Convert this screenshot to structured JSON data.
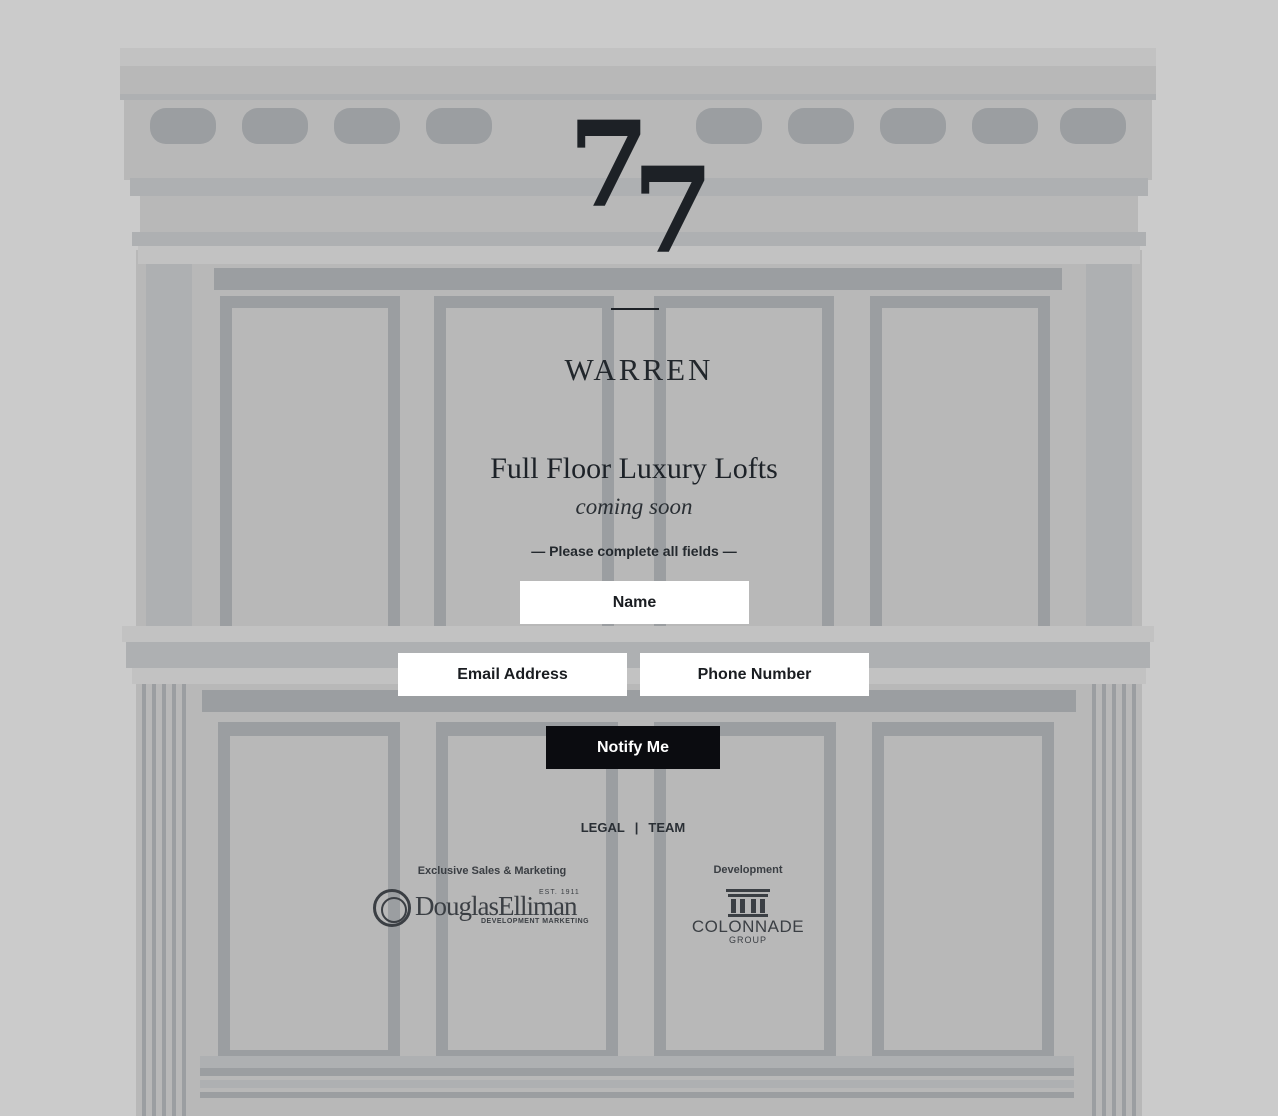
{
  "brand": {
    "logo_digits": [
      "7",
      "7"
    ],
    "wordmark": "WARREN"
  },
  "hero": {
    "headline": "Full Floor Luxury Lofts",
    "subhead": "coming soon",
    "instruction": "— Please complete all fields —"
  },
  "form": {
    "name_placeholder": "Name",
    "email_placeholder": "Email Address",
    "phone_placeholder": "Phone Number",
    "submit_label": "Notify Me"
  },
  "footer": {
    "links": [
      "LEGAL",
      "TEAM"
    ],
    "separator": "|",
    "sales_label": "Exclusive Sales & Marketing",
    "development_label": "Development",
    "sales_partner": {
      "name": "DouglasElliman",
      "est": "EST. 1911",
      "sub": "DEVELOPMENT MARKETING"
    },
    "development_partner": {
      "name": "COLONNADE",
      "sub": "GROUP"
    }
  },
  "colors": {
    "background": "#cbcbcb",
    "facade": "#b8b8b8",
    "button": "#0b0c10",
    "text": "#1d2126"
  }
}
